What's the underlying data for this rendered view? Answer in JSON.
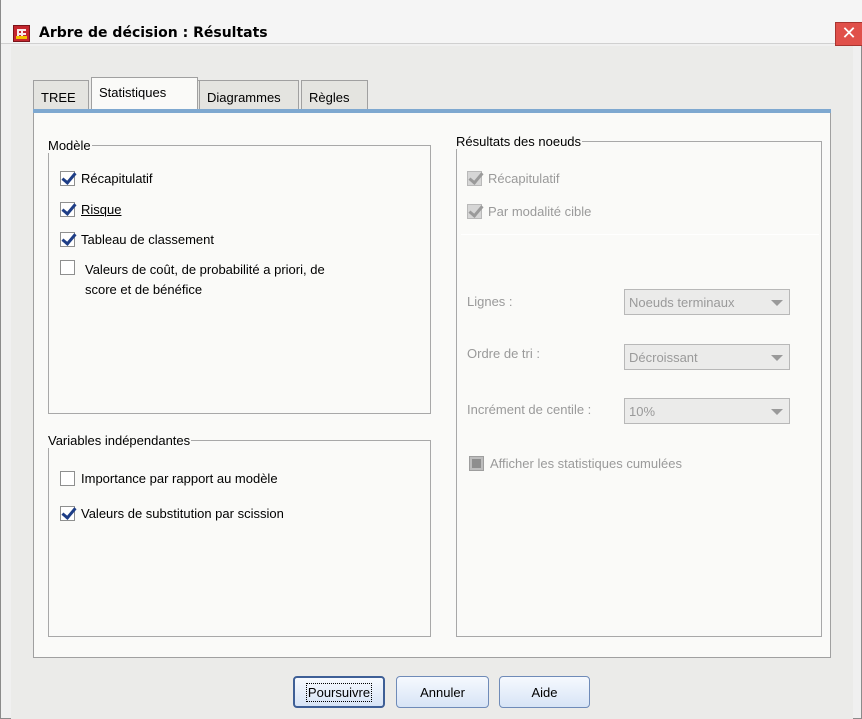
{
  "window": {
    "title": "Arbre de décision : Résultats",
    "close_glyph": "✕"
  },
  "tabs": [
    {
      "label": "TREE",
      "active": false
    },
    {
      "label": "Statistiques",
      "active": true
    },
    {
      "label": "Diagrammes",
      "active": false
    },
    {
      "label": "Règles",
      "active": false
    }
  ],
  "modele": {
    "legend": "Modèle",
    "items": [
      {
        "label": "Récapitulatif",
        "checked": true
      },
      {
        "label": "Risque",
        "checked": true
      },
      {
        "label": "Tableau de classement",
        "checked": true
      },
      {
        "label_line1": "Valeurs de coût, de probabilité a priori, de",
        "label_line2": "score et de bénéfice",
        "checked": false
      }
    ]
  },
  "variables": {
    "legend": "Variables indépendantes",
    "items": [
      {
        "label": "Importance par rapport au modèle",
        "checked": false
      },
      {
        "label": "Valeurs de substitution par scission",
        "checked": true
      }
    ]
  },
  "noeuds": {
    "legend": "Résultats des noeuds",
    "items": [
      {
        "label": "Récapitulatif",
        "checked": true,
        "enabled": false
      },
      {
        "label": "Par modalité cible",
        "checked": true,
        "enabled": false
      }
    ],
    "lignes_label": "Lignes :",
    "lignes_value": "Noeuds terminaux",
    "ordre_label": "Ordre de tri :",
    "ordre_value": "Décroissant",
    "increment_label": "Incrément de centile :",
    "increment_value": "10%",
    "cumul_label": "Afficher les statistiques cumulées"
  },
  "buttons": {
    "continue": "Poursuivre",
    "cancel": "Annuler",
    "help": "Aide"
  },
  "colors": {
    "tab_accent": "#7ea8d0",
    "check_mark": "#1d3d86",
    "close_button": "#e0504a"
  }
}
